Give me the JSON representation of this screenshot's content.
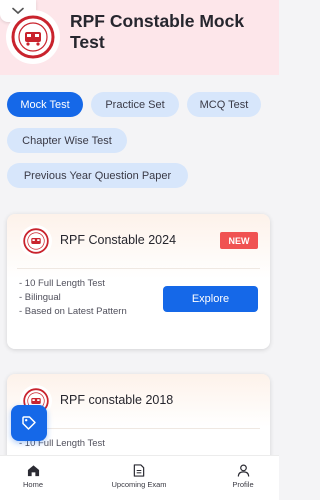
{
  "header": {
    "title": "RPF Constable Mock Test",
    "collapse_icon": "chevron-down-icon",
    "logo_icon": "railway-emblem-icon"
  },
  "tabs": [
    {
      "label": "Mock Test",
      "active": true
    },
    {
      "label": "Practice Set",
      "active": false
    },
    {
      "label": "MCQ Test",
      "active": false
    },
    {
      "label": "Chapter Wise Test",
      "active": false
    },
    {
      "label": "Previous Year Question Paper",
      "active": false
    }
  ],
  "cards": [
    {
      "title": "RPF Constable 2024",
      "badge": "NEW",
      "features": [
        "- 10 Full Length Test",
        "- Bilingual",
        "- Based on Latest Pattern"
      ],
      "button": "Explore"
    },
    {
      "title": "RPF constable 2018",
      "features": [
        "- 10 Full Length Test"
      ]
    }
  ],
  "fab": {
    "icon": "tag-icon"
  },
  "bottom_nav": [
    {
      "label": "Home",
      "icon": "home-icon"
    },
    {
      "label": "Upcoming Exam",
      "icon": "document-icon"
    },
    {
      "label": "Profile",
      "icon": "profile-icon"
    }
  ],
  "colors": {
    "primary": "#1568e8",
    "chip_bg": "#d7e6fb",
    "header_bg": "#fde6ea",
    "badge": "#f05252",
    "emblem_red": "#c9232d"
  }
}
